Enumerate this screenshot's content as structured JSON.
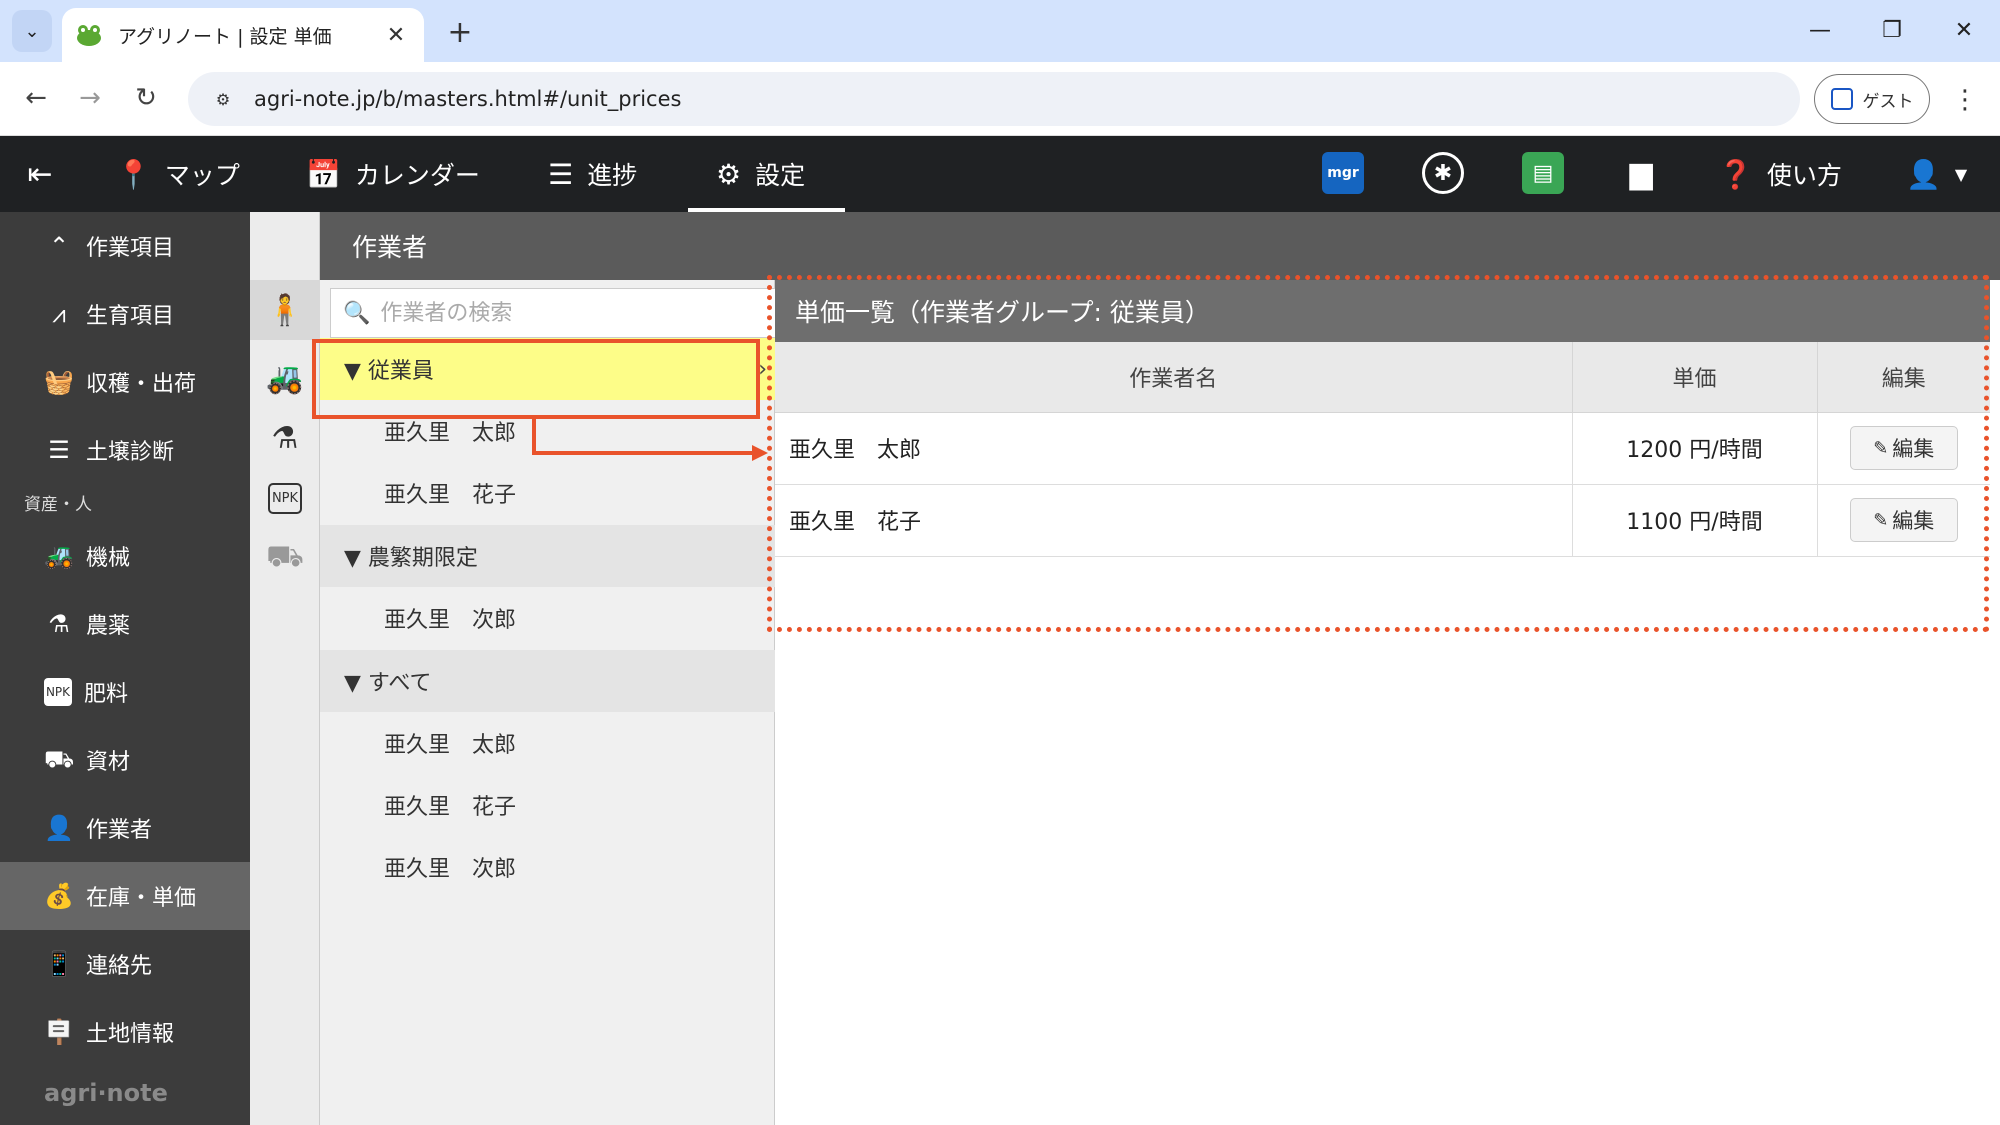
{
  "browser": {
    "tab_title": "アグリノート | 設定 単価",
    "url": "agri-note.jp/b/masters.html#/unit_prices",
    "profile_label": "ゲスト"
  },
  "header": {
    "nav": [
      {
        "label": "マップ",
        "icon": "map-pin-icon"
      },
      {
        "label": "カレンダー",
        "icon": "calendar-icon"
      },
      {
        "label": "進捗",
        "icon": "list-icon"
      },
      {
        "label": "設定",
        "icon": "gear-icon",
        "active": true
      }
    ],
    "mgr_label": "mgr",
    "help_label": "使い方"
  },
  "sidebar": {
    "items_top": [
      {
        "label": "作業項目",
        "icon": "work-icon"
      },
      {
        "label": "生育項目",
        "icon": "growth-icon"
      },
      {
        "label": "収穫・出荷",
        "icon": "basket-icon"
      },
      {
        "label": "土壌診断",
        "icon": "sliders-icon"
      }
    ],
    "section_label": "資産・人",
    "items_assets": [
      {
        "label": "機械",
        "icon": "tractor-icon"
      },
      {
        "label": "農薬",
        "icon": "flask-icon"
      },
      {
        "label": "肥料",
        "icon": "npk-icon"
      },
      {
        "label": "資材",
        "icon": "wheelbarrow-icon"
      },
      {
        "label": "作業者",
        "icon": "person-icon"
      },
      {
        "label": "在庫・単価",
        "icon": "money-bag-icon",
        "active": true
      },
      {
        "label": "連絡先",
        "icon": "phone-icon"
      },
      {
        "label": "土地情報",
        "icon": "sign-icon"
      }
    ],
    "logo_text": "agri·note"
  },
  "content": {
    "header_title": "作業者",
    "search_placeholder": "作業者の検索",
    "groups": [
      {
        "name": "▼ 従業員",
        "members": [
          "亜久里　太郎",
          "亜久里　花子"
        ],
        "selected": true
      },
      {
        "name": "▼ 農繁期限定",
        "members": [
          "亜久里　次郎"
        ]
      },
      {
        "name": "▼ すべて",
        "members": [
          "亜久里　太郎",
          "亜久里　花子",
          "亜久里　次郎"
        ]
      }
    ],
    "detail": {
      "title": "単価一覧（作業者グループ: 従業員）",
      "columns": [
        "作業者名",
        "単価",
        "編集"
      ],
      "rows": [
        {
          "name": "亜久里　太郎",
          "price": "1200 円/時間",
          "edit": "編集"
        },
        {
          "name": "亜久里　花子",
          "price": "1100 円/時間",
          "edit": "編集"
        }
      ]
    }
  },
  "colors": {
    "header_bg": "#1f2123",
    "sidebar_bg": "#3c3c3c",
    "selected_group": "#fdfd88",
    "annotation": "#e9532b"
  }
}
